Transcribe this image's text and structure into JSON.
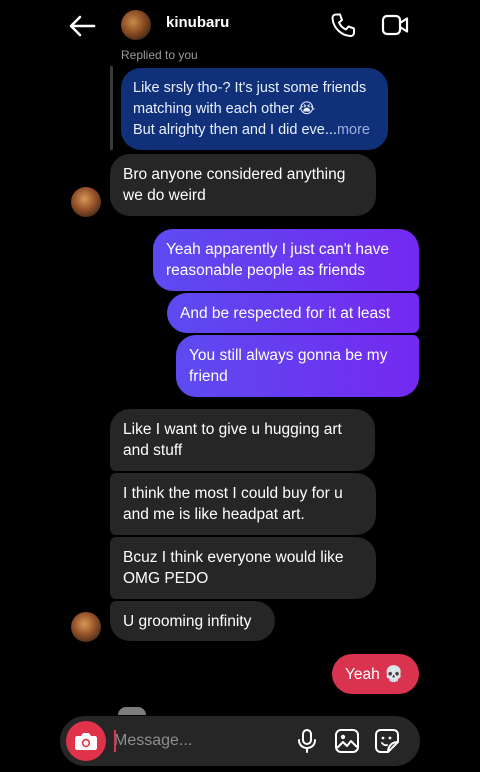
{
  "header": {
    "username": "kinubaru"
  },
  "reply": {
    "label": "Replied to you",
    "line1": "Like srsly tho-? It's just some friends",
    "line2": "matching with each other 😭",
    "line3": "But alrighty then and I did eve...",
    "more": "more"
  },
  "messages": [
    {
      "side": "in",
      "lines": [
        "Bro anyone considered anything",
        "we do weird"
      ]
    },
    {
      "side": "out",
      "lines": [
        "Yeah apparently I just can't have",
        "reasonable people as friends"
      ]
    },
    {
      "side": "out",
      "lines": [
        "And be respected for it at least"
      ]
    },
    {
      "side": "out",
      "lines": [
        "You still always gonna be my",
        "friend"
      ]
    },
    {
      "side": "in",
      "lines": [
        "Like I want to give u hugging art",
        "and stuff"
      ]
    },
    {
      "side": "in",
      "lines": [
        "I think the most I could buy for u",
        "and me is like headpat art."
      ]
    },
    {
      "side": "in",
      "lines": [
        "Bcuz I think everyone would like",
        "OMG PEDO"
      ]
    },
    {
      "side": "in",
      "lines": [
        "U grooming infinity"
      ]
    },
    {
      "side": "out",
      "lines": [
        "Yeah 💀"
      ]
    }
  ],
  "composer": {
    "placeholder": "Message..."
  },
  "colors": {
    "outgoing_gradient_start": "#5c4bf0",
    "outgoing_gradient_end": "#7429f0",
    "incoming": "#262626",
    "reply_bubble": "#10317a",
    "last_outgoing": "#d9334f",
    "camera_button": "#e03349"
  }
}
